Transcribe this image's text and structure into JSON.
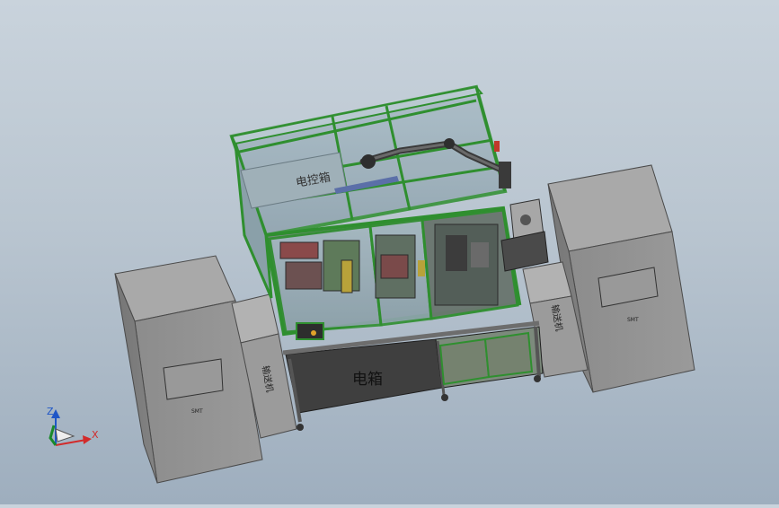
{
  "scene": {
    "background_top": "#c9d3dc",
    "background_bottom": "#9eaebe",
    "frame_color": "#2f8f2f",
    "glass_color": "#9fb3bf",
    "cabinet_color": "#8f8f8f"
  },
  "labels": {
    "control_cabinet": "电控箱",
    "electrical_box": "电箱",
    "left_conveyor": "输送机",
    "right_conveyor": "输送机",
    "left_smt": "SMT",
    "right_smt": "SMT"
  },
  "triad": {
    "x_label": "X",
    "z_label": "Z",
    "x_color": "#d22b2b",
    "z_color": "#1f56c7",
    "y_color": "#1a8a2a"
  }
}
